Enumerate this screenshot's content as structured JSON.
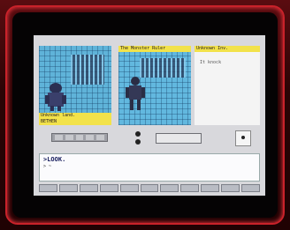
{
  "title": "",
  "panels": {
    "left_caption_1": "Unknown land.",
    "left_caption_2": "BETHEN",
    "middle_title": "The Monster Ruler",
    "right_title": "Unknown Inv.",
    "right_text": "It knock"
  },
  "controls": {
    "arrow_labels": [
      "",
      "",
      "",
      "",
      ""
    ]
  },
  "console": {
    "command": ">LOOK.",
    "second_line": "> ~"
  },
  "menu_items": [
    "",
    "",
    "",
    "",
    "",
    "",
    "",
    "",
    "",
    "",
    ""
  ]
}
